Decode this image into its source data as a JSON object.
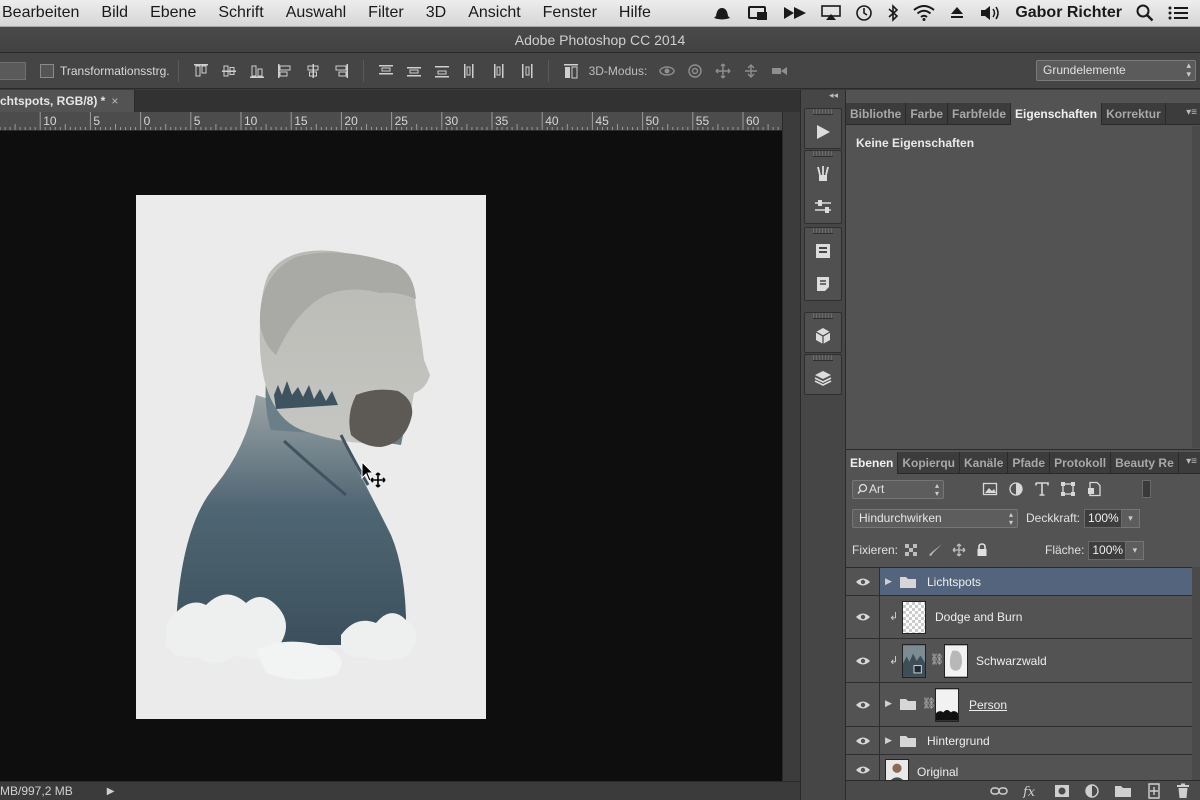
{
  "menubar": {
    "items": [
      "Bearbeiten",
      "Bild",
      "Ebene",
      "Schrift",
      "Auswahl",
      "Filter",
      "3D",
      "Ansicht",
      "Fenster",
      "Hilfe"
    ],
    "user": "Gabor Richter"
  },
  "window": {
    "title": "Adobe Photoshop CC 2014"
  },
  "options": {
    "transform_label": "Transformationsstrg.",
    "mode_3d_label": "3D-Modus:",
    "workspace": "Grundelemente"
  },
  "document": {
    "tab_title": "chtspots, RGB/8) *",
    "close_glyph": "×",
    "status_text": "MB/997,2 MB",
    "status_arrow": "▶"
  },
  "ruler": {
    "labels": [
      "5",
      "10",
      "5",
      "0",
      "5",
      "10",
      "15",
      "20",
      "25",
      "30",
      "35",
      "40",
      "45",
      "50",
      "55",
      "60"
    ]
  },
  "properties_panel": {
    "tabs": [
      "Bibliothe",
      "Farbe",
      "Farbfelde",
      "Eigenschaften",
      "Korrektur"
    ],
    "active_tab": "Eigenschaften",
    "empty_text": "Keine Eigenschaften"
  },
  "layers_panel": {
    "tabs": [
      "Ebenen",
      "Kopierqu",
      "Kanäle",
      "Pfade",
      "Protokoll",
      "Beauty Re"
    ],
    "active_tab": "Ebenen",
    "filter_kind": "Art",
    "blend_mode": "Hindurchwirken",
    "opacity_label": "Deckkraft:",
    "opacity": "100%",
    "lock_label": "Fixieren:",
    "fill_label": "Fläche:",
    "fill": "100%",
    "layers": [
      {
        "name": "Lichtspots",
        "kind": "group",
        "selected": true
      },
      {
        "name": "Dodge and Burn",
        "kind": "clipped-layer"
      },
      {
        "name": "Schwarzwald",
        "kind": "clipped-layer-with-mask"
      },
      {
        "name": "Person",
        "kind": "group-with-mask"
      },
      {
        "name": "Hintergrund",
        "kind": "group"
      },
      {
        "name": "Original",
        "kind": "layer"
      }
    ]
  },
  "colors": {
    "canvas_bg": "#0e0e0e",
    "selected_layer": "#53647c",
    "panel_bg": "#535353"
  }
}
